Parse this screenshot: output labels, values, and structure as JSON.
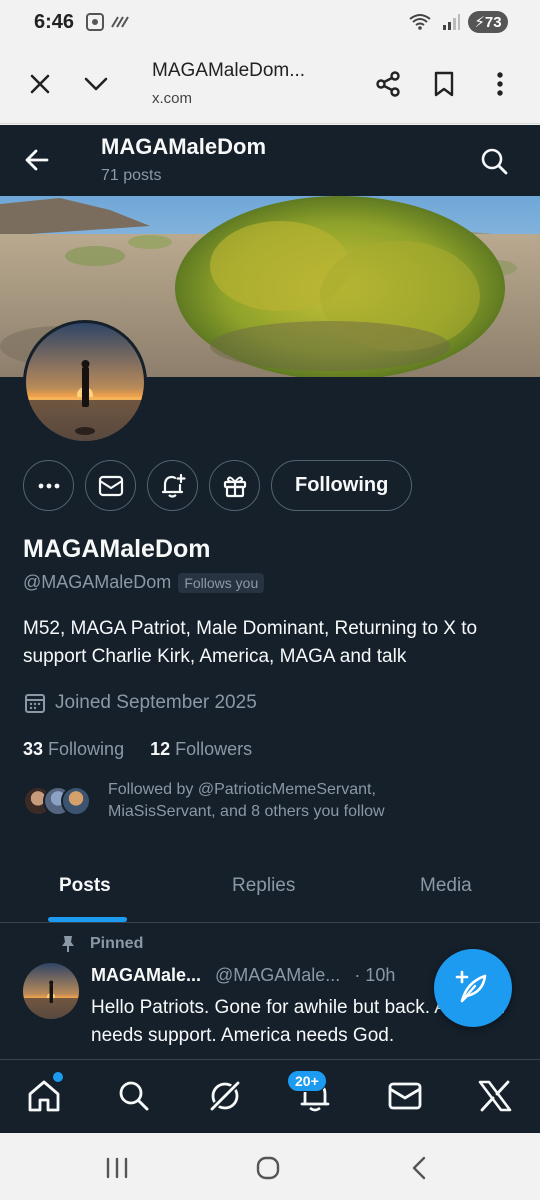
{
  "status_bar": {
    "time": "6:46",
    "battery": "73"
  },
  "browser": {
    "title": "MAGAMaleDom...",
    "url": "x.com"
  },
  "profile_header": {
    "name": "MAGAMaleDom",
    "post_count": "71 posts"
  },
  "profile": {
    "display_name": "MAGAMaleDom",
    "handle": "@MAGAMaleDom",
    "follows_you": "Follows you",
    "following_button": "Following",
    "bio": "M52, MAGA Patriot, Male Dominant, Returning to X to support Charlie Kirk, America, MAGA and talk",
    "joined": "Joined September 2025",
    "following_count": "33",
    "following_label": "Following",
    "followers_count": "12",
    "followers_label": "Followers",
    "followed_by": "Followed by @PatrioticMemeServant, MiaSisServant, and 8 others you follow"
  },
  "tabs": [
    {
      "label": "Posts",
      "active": true
    },
    {
      "label": "Replies",
      "active": false
    },
    {
      "label": "Media",
      "active": false
    }
  ],
  "pinned_post": {
    "pinned_label": "Pinned",
    "author_name": "MAGAMale...",
    "author_handle": "@MAGAMale...",
    "time": "· 10h",
    "text": "Hello Patriots. Gone for awhile but back. America needs support. America needs God."
  },
  "bottom_nav": {
    "notifications_badge": "20+"
  },
  "colors": {
    "background": "#15202b",
    "accent": "#1d9bf0",
    "muted_text": "#8b98a5",
    "border": "#536471"
  }
}
